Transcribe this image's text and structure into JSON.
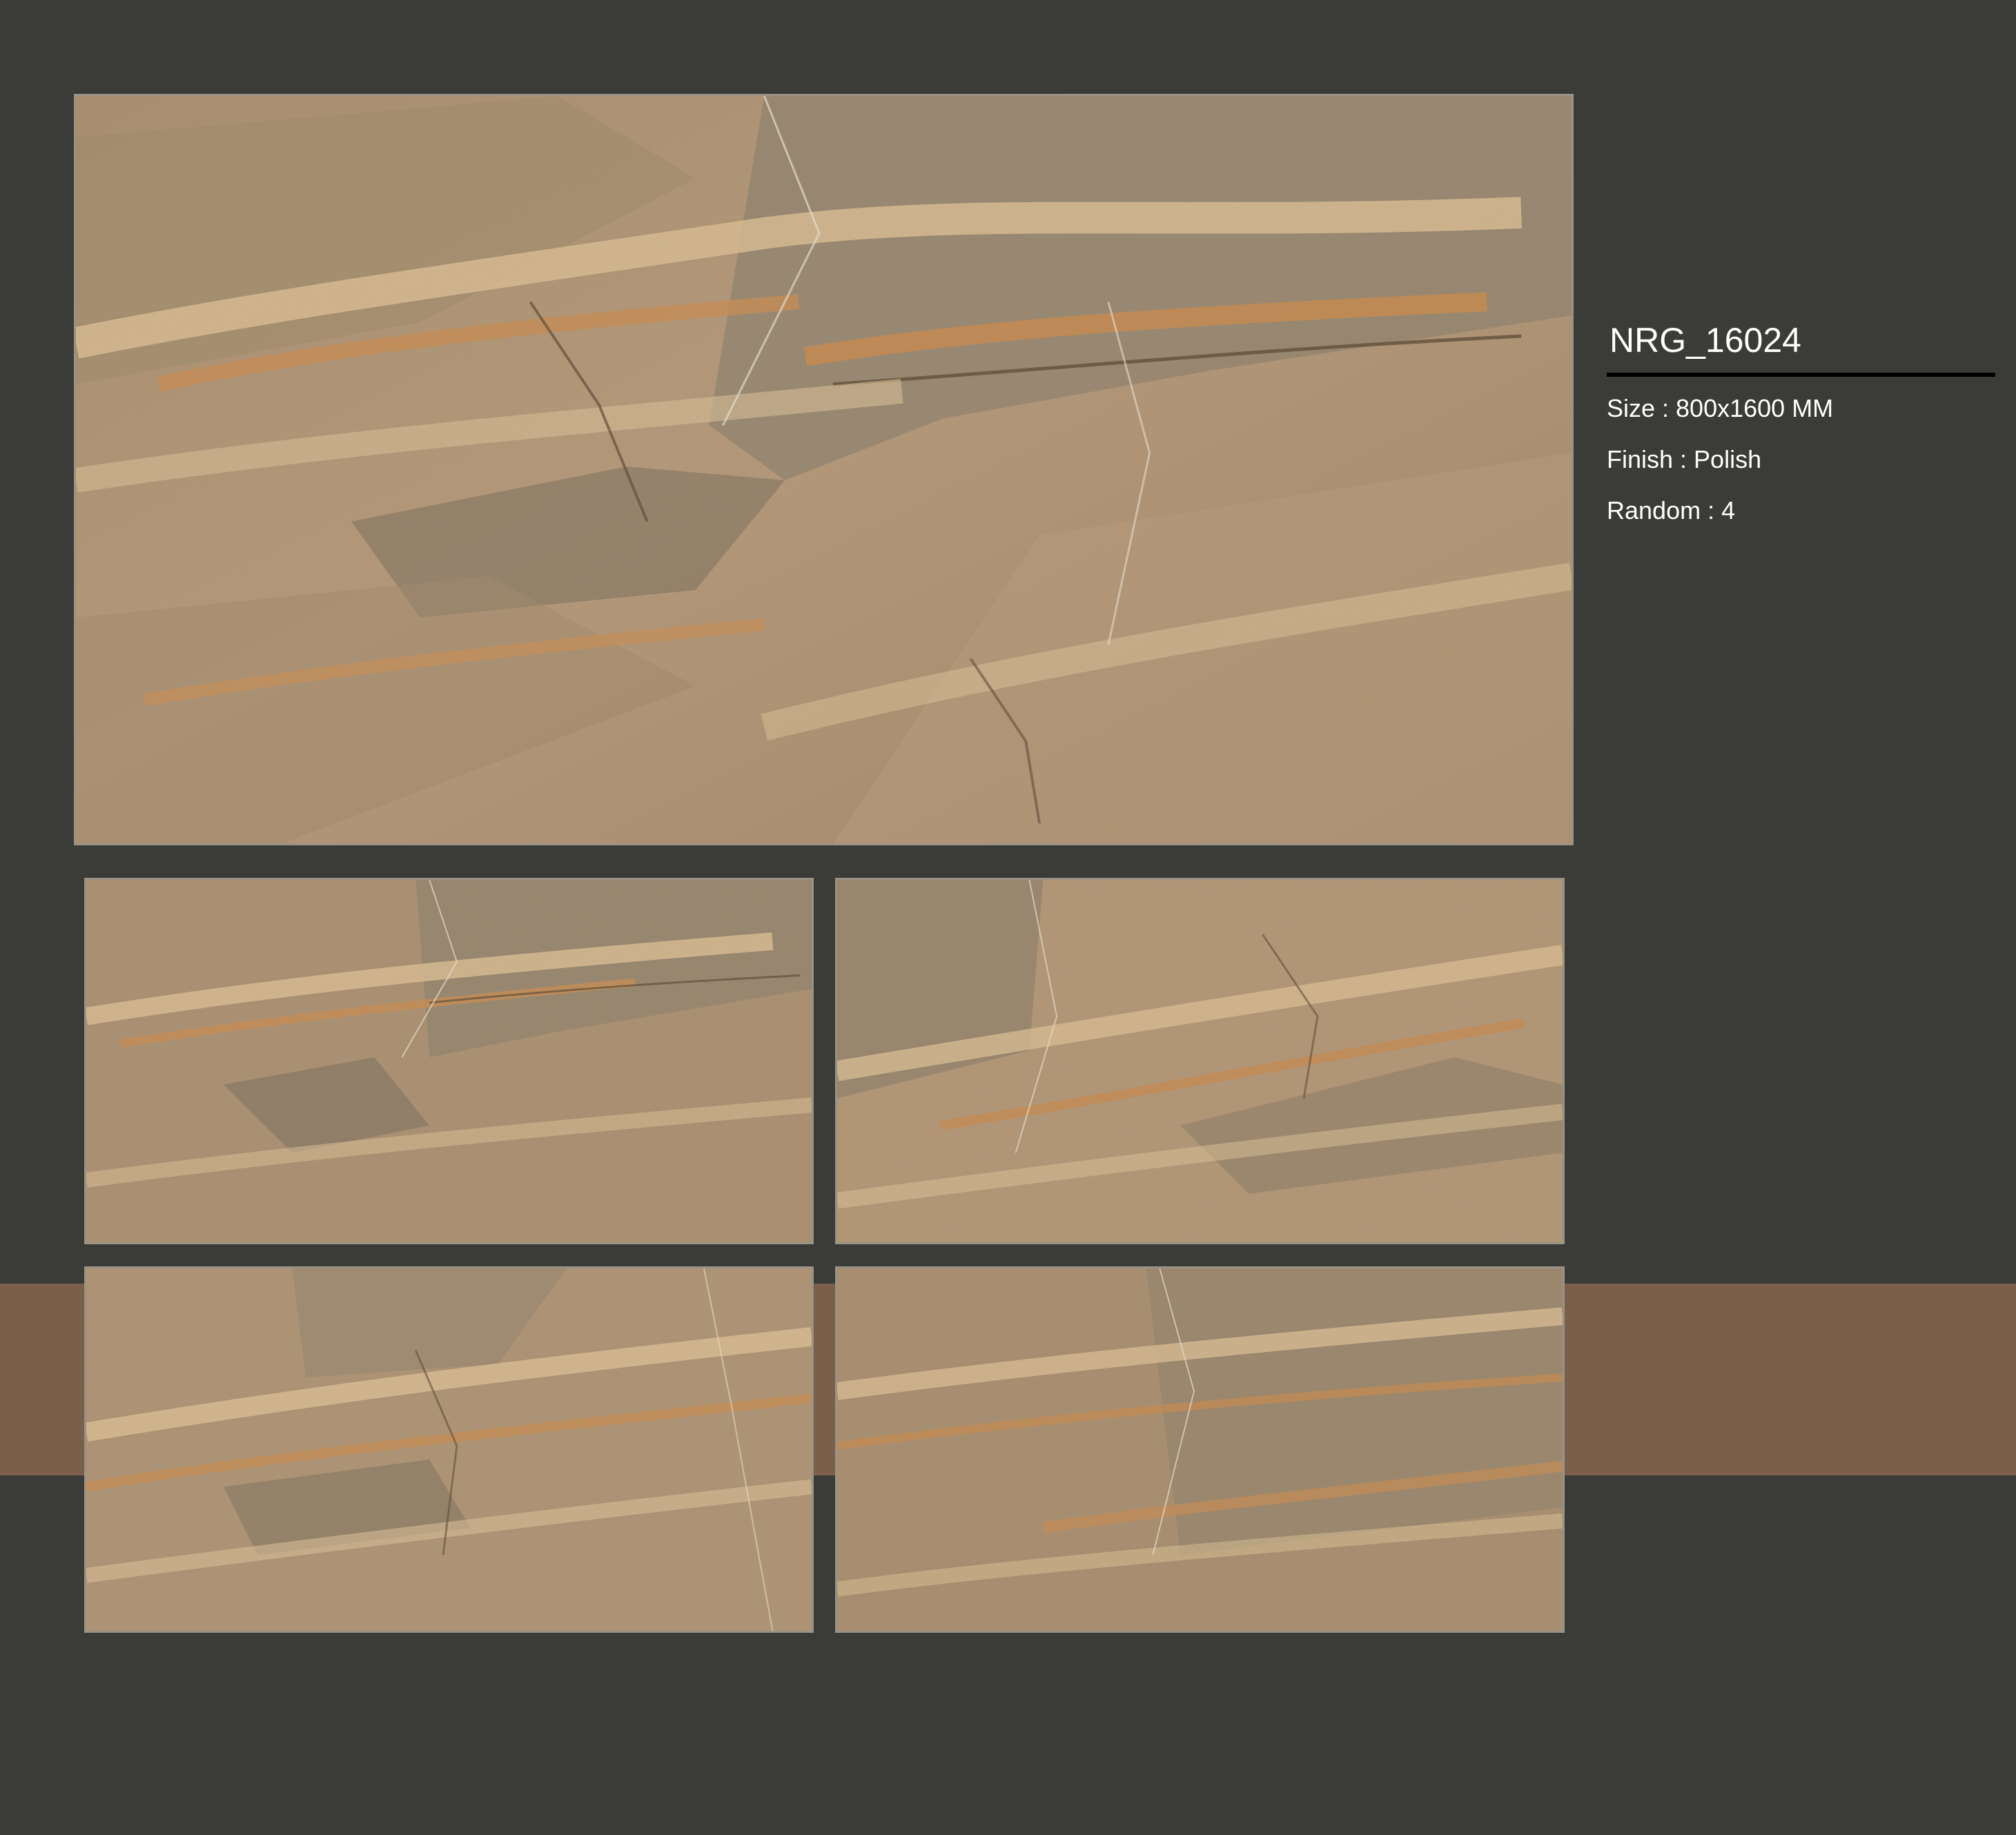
{
  "product": {
    "code": "NRG_16024",
    "specs": [
      {
        "label": "Size",
        "value": "800x1600 MM",
        "text": "Size : 800x1600 MM"
      },
      {
        "label": "Finish",
        "value": "Polish",
        "text": "Finish : Polish"
      },
      {
        "label": "Random",
        "value": "4",
        "text": "Random : 4"
      }
    ]
  },
  "colors": {
    "background": "#3b3b37",
    "accent_band": "#7a604b",
    "stone_base": "#b09373",
    "stone_grey": "#7f7565",
    "stone_light": "#d7b98f",
    "stone_orange": "#c78a4f",
    "stone_dark_vein": "#5b4a35",
    "text": "#ffffff",
    "rule": "#000000"
  },
  "tiles": [
    {
      "name": "main-tile",
      "kind": "full-slab"
    },
    {
      "name": "variation-1",
      "kind": "random-face"
    },
    {
      "name": "variation-2",
      "kind": "random-face"
    },
    {
      "name": "variation-3",
      "kind": "random-face"
    },
    {
      "name": "variation-4",
      "kind": "random-face"
    }
  ]
}
